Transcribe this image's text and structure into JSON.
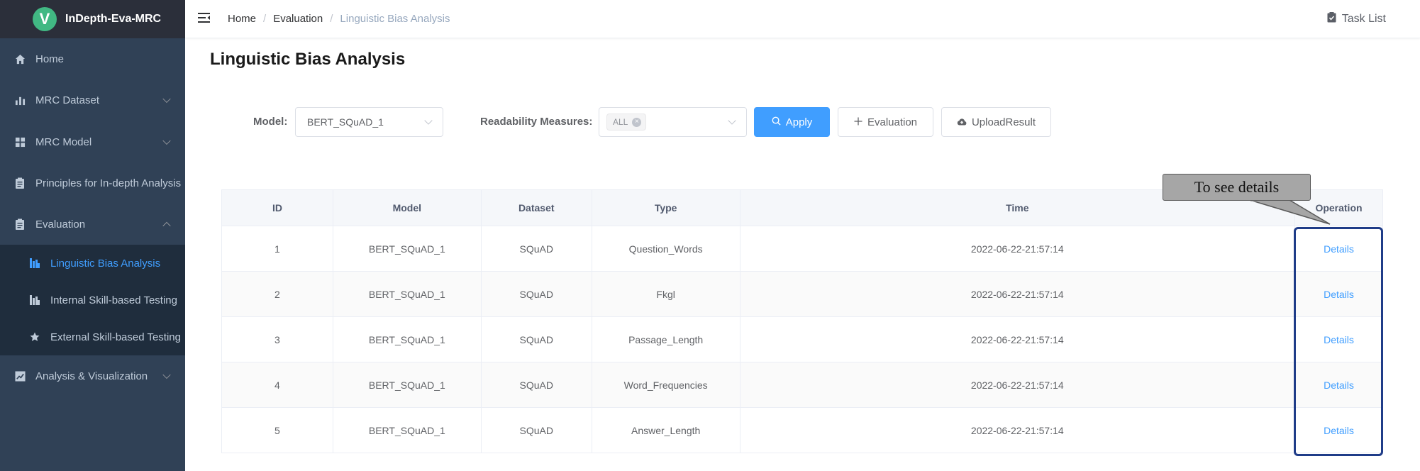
{
  "app": {
    "title": "InDepth-Eva-MRC",
    "logo_letter": "V",
    "accent": "#409eff",
    "sidebar_bg": "#304156"
  },
  "sidebar": {
    "items": [
      {
        "label": "Home",
        "icon": "home-icon"
      },
      {
        "label": "MRC Dataset",
        "icon": "bar-chart-icon"
      },
      {
        "label": "MRC Model",
        "icon": "grid-icon"
      },
      {
        "label": "Principles for In-depth Analysis",
        "icon": "clipboard-icon"
      },
      {
        "label": "Evaluation",
        "icon": "clipboard-icon"
      },
      {
        "label": "Analysis & Visualization",
        "icon": "line-chart-icon"
      }
    ],
    "evaluation_sub": [
      {
        "label": "Linguistic Bias Analysis",
        "icon": "chart-bars-icon",
        "active": true
      },
      {
        "label": "Internal Skill-based Testing",
        "icon": "chart-bars-icon"
      },
      {
        "label": "External Skill-based Testing",
        "icon": "star-icon"
      }
    ]
  },
  "header": {
    "breadcrumb": [
      "Home",
      "Evaluation",
      "Linguistic Bias Analysis"
    ],
    "task_list": "Task List"
  },
  "page": {
    "title": "Linguistic Bias Analysis"
  },
  "filters": {
    "model_label": "Model:",
    "model_value": "BERT_SQuAD_1",
    "readability_label": "Readability Measures:",
    "readability_tag": "ALL",
    "apply": "Apply",
    "evaluation": "Evaluation",
    "upload": "UploadResult"
  },
  "table": {
    "columns": [
      "ID",
      "Model",
      "Dataset",
      "Type",
      "Time",
      "Operation"
    ],
    "rows": [
      {
        "id": "1",
        "model": "BERT_SQuAD_1",
        "dataset": "SQuAD",
        "type": "Question_Words",
        "time": "2022-06-22-21:57:14",
        "op": "Details"
      },
      {
        "id": "2",
        "model": "BERT_SQuAD_1",
        "dataset": "SQuAD",
        "type": "Fkgl",
        "time": "2022-06-22-21:57:14",
        "op": "Details"
      },
      {
        "id": "3",
        "model": "BERT_SQuAD_1",
        "dataset": "SQuAD",
        "type": "Passage_Length",
        "time": "2022-06-22-21:57:14",
        "op": "Details"
      },
      {
        "id": "4",
        "model": "BERT_SQuAD_1",
        "dataset": "SQuAD",
        "type": "Word_Frequencies",
        "time": "2022-06-22-21:57:14",
        "op": "Details"
      },
      {
        "id": "5",
        "model": "BERT_SQuAD_1",
        "dataset": "SQuAD",
        "type": "Answer_Length",
        "time": "2022-06-22-21:57:14",
        "op": "Details"
      }
    ]
  },
  "annotation": {
    "callout": "To see details"
  }
}
